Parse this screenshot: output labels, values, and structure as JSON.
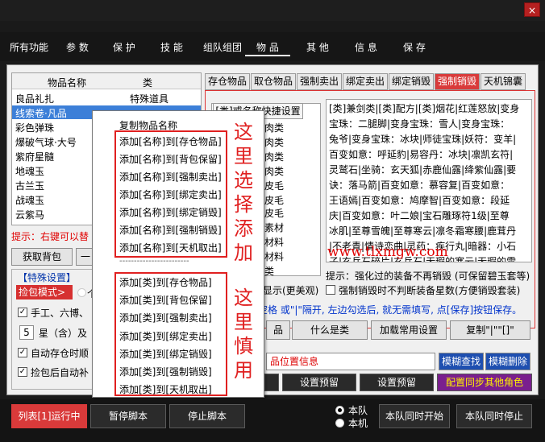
{
  "window": {
    "close_symbol": "×"
  },
  "menu": {
    "items": [
      "所有功能",
      "参 数",
      "保 护",
      "技 能",
      "组队组团",
      "物 品",
      "其 他",
      "信 息",
      "保 存"
    ],
    "active": "物 品"
  },
  "left_list": {
    "columns": [
      "物品名称",
      "类"
    ],
    "rows": [
      {
        "name": "良品礼扎",
        "type": "特殊道具"
      },
      {
        "name": "线索卷·凡品",
        "type": "",
        "selected": true
      },
      {
        "name": "彩色弹珠",
        "type": ""
      },
      {
        "name": "爆破气球·大号",
        "type": ""
      },
      {
        "name": "紫府星髓",
        "type": ""
      },
      {
        "name": "地魂玉",
        "type": ""
      },
      {
        "name": "古兰玉",
        "type": ""
      },
      {
        "name": "战魂玉",
        "type": ""
      },
      {
        "name": "云紫马",
        "type": ""
      }
    ]
  },
  "left_hint": "提示：右键可以替",
  "buttons": {
    "get_bag": "获取背包",
    "small": "一"
  },
  "special": {
    "title": "【特殊设置】",
    "pickup_mode": "捡包模式>",
    "radio_partial": "个",
    "cb1": "手工、六博、",
    "star_value": "5",
    "star_label": "星（含）及",
    "cb2": "自动存仓时顺",
    "cb3": "捡包后自动补"
  },
  "tabs": [
    "存仓物品",
    "取仓物品",
    "强制卖出",
    "绑定卖出",
    "绑定销毁",
    "强制销毁",
    "天机锦囊"
  ],
  "active_tab": "强制销毁",
  "mid": {
    "header": "[类]或名称快捷设置",
    "rows": [
      "肉类",
      "肉类",
      "肉类",
      "肉类",
      "皮毛",
      "皮毛",
      "皮毛",
      "素材",
      "材料",
      "材料",
      "材料",
      "类"
    ]
  },
  "text_area": [
    "[类]兼剑类|[类]配方|[类]烟花|红莲怒放|变身",
    "宝珠：二腿脚|变身宝珠：雪人|变身宝珠：",
    "兔爷|变身宝珠：冰块|师徒宝珠|妖符：变羊|",
    "百变如意：呼延豹|易容丹：冰块|凛凯玄符|",
    "灵鹫石|坐骑：玄天狐|赤鹿仙露|绛紫仙露|要",
    "诀：落马箭|百变如意：慕容复|百变如意：",
    "王语嫣|百变如意：鸠摩智|百变如意：段延",
    "庆|百变如意：叶二娘|宝石雕琢符1级|至尊",
    "冰肌|至尊雪魄|至尊寒云|凛冬霜寒腰|鹿茸丹",
    "|不老青|情诗恋曲|灵药：疾行丸|暗器：小石",
    "子|玄兵石碎片|玄兵石|无瑕的寒云|无瑕的雪"
  ],
  "watermark": "www.tlxmgw.com",
  "tip_strong": "提示：强化过的装备不再销毁 (可保留碧玉套等)",
  "options_row": {
    "display_label": "显示(更美观)",
    "cb_label": "强制销毁时不判断装备星数(方便销毁套装)"
  },
  "tip_blue": "空格 或\"|\"隔开, 左边勾选后, 就无需填写, 点[保存]按钮保存。",
  "action_buttons": {
    "pin": "品",
    "what_is_class": "什么是类",
    "load_common": "加载常用设置",
    "copy": "复制\"|\"\"[]\""
  },
  "position_info": "品位置信息",
  "fuzzy_find": "模糊查找",
  "fuzzy_delete": "模糊删除",
  "set_preset_1": "设置预留",
  "set_preset_2": "设置预留",
  "sync_roles": "配置同步其他角色",
  "context_menu": {
    "items_a": [
      "复制物品名称",
      "添加[名称]到[存仓物品]",
      "添加[名称]到[背包保留]",
      "添加[名称]到[强制卖出]",
      "添加[名称]到[绑定卖出]",
      "添加[名称]到[绑定销毁]",
      "添加[名称]到[强制销毁]",
      "添加[名称]到[天机取出]"
    ],
    "separator": "------------------------",
    "items_b": [
      "添加[类]到[存仓物品]",
      "添加[类]到[背包保留]",
      "添加[类]到[强制卖出]",
      "添加[类]到[绑定卖出]",
      "添加[类]到[绑定销毁]",
      "添加[类]到[强制销毁]",
      "添加[类]到[天机取出]"
    ]
  },
  "annotations": {
    "top": [
      "这",
      "里",
      "选",
      "择",
      "添",
      "加"
    ],
    "bottom": [
      "这",
      "里",
      "慎",
      "用"
    ],
    "red": "#e02020"
  },
  "bottom": {
    "run_status": "列表[1]运行中",
    "pause": "暂停脚本",
    "stop": "停止脚本",
    "radio_team": "本队",
    "radio_self": "本机",
    "team_start": "本队同时开始",
    "team_stop": "本队同时停止"
  },
  "colors": {
    "accent_red": "#d93a3a",
    "selection_blue": "#3c7fd8"
  }
}
